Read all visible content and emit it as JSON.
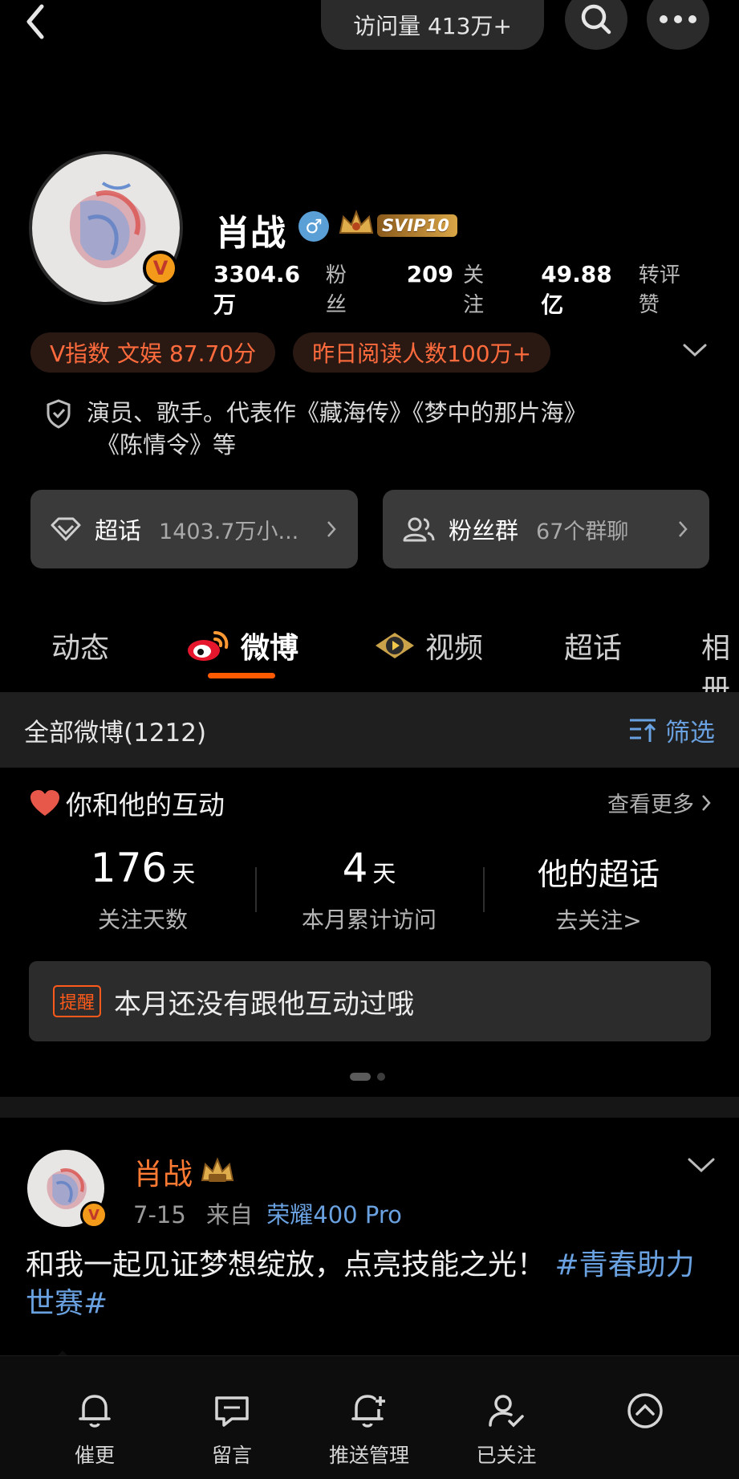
{
  "header": {
    "visits": "访问量 413万+",
    "icons": [
      "back-icon",
      "search-icon",
      "more-icon"
    ]
  },
  "profile": {
    "name": "肖战",
    "gender_symbol": "♂",
    "svip_label": "SVIP10",
    "verified_badge": "V",
    "stats": [
      {
        "value": "3304.6万",
        "label": "粉丝"
      },
      {
        "value": "209",
        "label": "关注"
      },
      {
        "value": "49.88亿",
        "label": "转评赞"
      }
    ],
    "chips": [
      "V指数 文娱 87.70分",
      "昨日阅读人数100万+"
    ],
    "bio_line1": "演员、歌手。代表作《藏海传》《梦中的那片海》",
    "bio_line2": "《陈情令》等"
  },
  "cards": {
    "super": {
      "title": "超话",
      "sub": "1403.7万小..."
    },
    "fans": {
      "title": "粉丝群",
      "sub": "67个群聊"
    }
  },
  "tabs": [
    "动态",
    "微博",
    "视频",
    "超话",
    "相册"
  ],
  "active_tab": "微博",
  "filter_bar": {
    "count": "全部微博(1212)",
    "filter": "筛选"
  },
  "interaction": {
    "title": "你和他的互动",
    "see_more": "查看更多",
    "follow_days": {
      "value": "176",
      "unit": "天",
      "label": "关注天数"
    },
    "monthly_visits": {
      "value": "4",
      "unit": "天",
      "label": "本月累计访问"
    },
    "super_topic": {
      "value": "他的超话",
      "label": "去关注>"
    },
    "reminder_tag": "提醒",
    "reminder_text": "本月还没有跟他互动过哦"
  },
  "post": {
    "author": "肖战",
    "verified_badge": "V",
    "date": "7-15",
    "source_prefix": "来自",
    "device": "荣耀400 Pro",
    "text": "和我一起见证梦想绽放，点亮技能之光！",
    "topic_line1": "#青春助",
    "topic_line2": "力世赛#"
  },
  "bottom_bar": {
    "items": [
      "催更",
      "留言",
      "推送管理",
      "已关注"
    ]
  },
  "colors": {
    "accent": "#ff5a00",
    "link": "#6aa1e0",
    "chip_text": "#ff6b3d",
    "verified": "#f39a1a"
  }
}
